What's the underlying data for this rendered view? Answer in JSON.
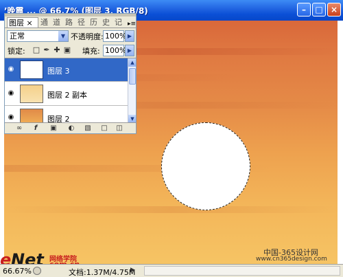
{
  "window": {
    "title": "’晚霞 ... @ 66.7% (图层 3, RGB/8)",
    "minimize": "–",
    "maximize": "□",
    "close": "×"
  },
  "colors": {
    "titlebar": "#0a4fd6",
    "sky_top": "#d9683a",
    "sky_bottom": "#f6c464",
    "selection": "#3168c7",
    "watermark_red": "#c81e1e"
  },
  "layers_panel": {
    "tabs": [
      "图层",
      "通",
      "道",
      "路",
      "径",
      "历",
      "史",
      "记"
    ],
    "tab_close": "×",
    "menu_icon": "▸≡",
    "blend_mode": "正常",
    "opacity_label": "不透明度:",
    "opacity_value": "100%",
    "lock_label": "锁定:",
    "fill_label": "填充:",
    "fill_value": "100%",
    "layers": [
      {
        "name": "图层 3",
        "selected": true,
        "visible": true
      },
      {
        "name": "图层 2 副本",
        "selected": false,
        "visible": true
      },
      {
        "name": "图层 2",
        "selected": false,
        "visible": true
      }
    ]
  },
  "status_bar": {
    "zoom": "66.67%",
    "doc_size": "文档:1.37M/4.75M"
  },
  "watermarks": {
    "cn365_line1": "中国-365设计网",
    "cn365_line2": "www.cn365design.com",
    "enet_e": "e",
    "enet_net": "Net",
    "enet_cn": "网络学院",
    "enet_domain": ".com.cn"
  }
}
